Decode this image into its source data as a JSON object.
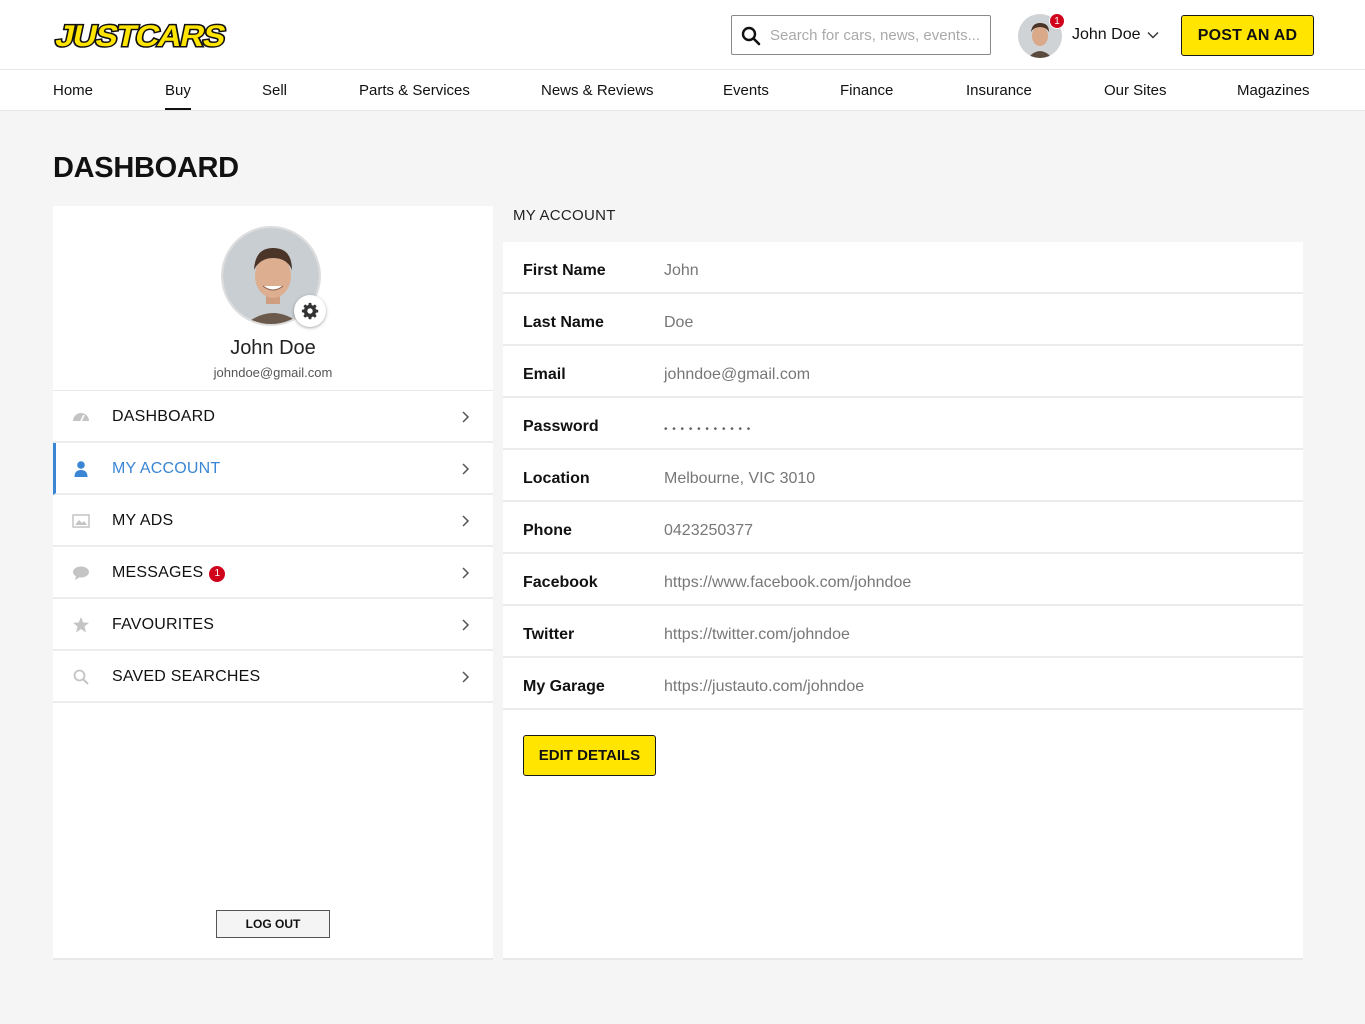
{
  "brand": {
    "logo_text": "JUSTCARS",
    "accent": "#ffe500",
    "link_blue": "#3a86d4",
    "badge_red": "#d0021b"
  },
  "header": {
    "search_placeholder": "Search for cars, news, events...",
    "user_name": "John Doe",
    "notification_count": "1",
    "post_ad_label": "POST AN AD"
  },
  "nav": {
    "items": [
      "Home",
      "Buy",
      "Sell",
      "Parts & Services",
      "News & Reviews",
      "Events",
      "Finance",
      "Insurance",
      "Our Sites",
      "Magazines"
    ],
    "active": "Buy"
  },
  "page": {
    "title": "DASHBOARD"
  },
  "profile": {
    "name": "John Doe",
    "email": "johndoe@gmail.com"
  },
  "sidebar": {
    "items": [
      {
        "label": "DASHBOARD",
        "icon": "speedometer-icon"
      },
      {
        "label": "MY ACCOUNT",
        "icon": "user-icon",
        "active": true
      },
      {
        "label": "MY ADS",
        "icon": "image-icon"
      },
      {
        "label": "MESSAGES",
        "icon": "chat-icon",
        "badge": "1"
      },
      {
        "label": "FAVOURITES",
        "icon": "star-icon"
      },
      {
        "label": "SAVED SEARCHES",
        "icon": "search-icon"
      }
    ],
    "logout_label": "LOG OUT"
  },
  "account": {
    "section_title": "MY ACCOUNT",
    "fields": [
      {
        "label": "First Name",
        "value": "John"
      },
      {
        "label": "Last Name",
        "value": "Doe"
      },
      {
        "label": "Email",
        "value": "johndoe@gmail.com"
      },
      {
        "label": "Password",
        "value": "• • • • • • • • • • •"
      },
      {
        "label": "Location",
        "value": "Melbourne, VIC 3010"
      },
      {
        "label": "Phone",
        "value": "0423250377"
      },
      {
        "label": "Facebook",
        "value": "https://www.facebook.com/johndoe"
      },
      {
        "label": "Twitter",
        "value": "https://twitter.com/johndoe"
      },
      {
        "label": "My Garage",
        "value": "https://justauto.com/johndoe"
      }
    ],
    "edit_label": "EDIT DETAILS"
  }
}
